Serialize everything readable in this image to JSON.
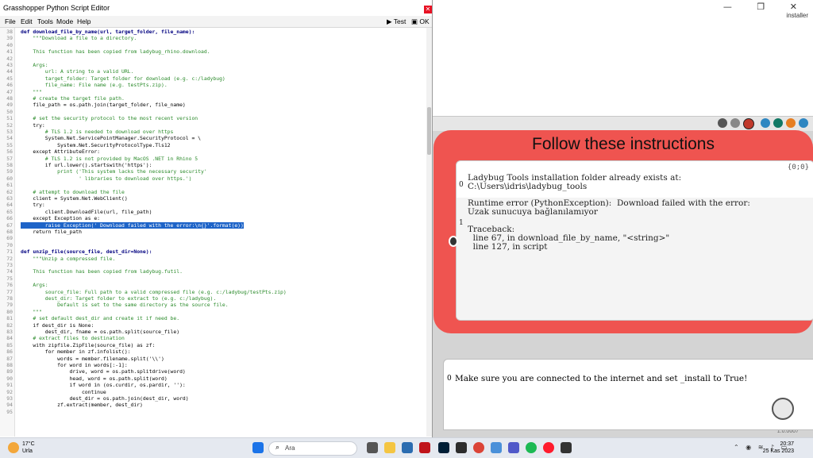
{
  "editor": {
    "title": "Grasshopper Python Script Editor",
    "close_glyph": "✕",
    "menu": [
      "File",
      "Edit",
      "Tools",
      "Mode",
      "Help"
    ],
    "test_label": "Test",
    "ok_label": "OK",
    "lines": [
      {
        "n": "38",
        "t": "def download_file_by_name(url, target_folder, file_name):",
        "k": "def"
      },
      {
        "n": "39",
        "t": "    \"\"\"Download a file to a directory.",
        "k": "str"
      },
      {
        "n": "40",
        "t": "",
        "k": ""
      },
      {
        "n": "41",
        "t": "    This function has been copied from ladybug_rhino.download.",
        "k": "str"
      },
      {
        "n": "42",
        "t": "",
        "k": ""
      },
      {
        "n": "43",
        "t": "    Args:",
        "k": "str"
      },
      {
        "n": "44",
        "t": "        url: A string to a valid URL.",
        "k": "str"
      },
      {
        "n": "45",
        "t": "        target_folder: Target folder for download (e.g. c:/ladybug)",
        "k": "str"
      },
      {
        "n": "46",
        "t": "        file_name: File name (e.g. testPts.zip).",
        "k": "str"
      },
      {
        "n": "47",
        "t": "    \"\"\"",
        "k": "str"
      },
      {
        "n": "48",
        "t": "    # create the target file path.",
        "k": "cmt"
      },
      {
        "n": "49",
        "t": "    file_path = os.path.join(target_folder, file_name)",
        "k": ""
      },
      {
        "n": "50",
        "t": "",
        "k": ""
      },
      {
        "n": "51",
        "t": "    # set the security protocol to the most recent version",
        "k": "cmt"
      },
      {
        "n": "52",
        "t": "    try:",
        "k": "kw"
      },
      {
        "n": "53",
        "t": "        # TLS 1.2 is needed to download over https",
        "k": "cmt"
      },
      {
        "n": "54",
        "t": "        System.Net.ServicePointManager.SecurityProtocol = \\",
        "k": ""
      },
      {
        "n": "55",
        "t": "            System.Net.SecurityProtocolType.Tls12",
        "k": ""
      },
      {
        "n": "56",
        "t": "    except AttributeError:",
        "k": "kw"
      },
      {
        "n": "57",
        "t": "        # TLS 1.2 is not provided by MacOS .NET in Rhino 5",
        "k": "cmt"
      },
      {
        "n": "58",
        "t": "        if url.lower().startswith('https'):",
        "k": "kw"
      },
      {
        "n": "59",
        "t": "            print ('This system lacks the necessary security'",
        "k": "str"
      },
      {
        "n": "60",
        "t": "                   ' libraries to download over https.')",
        "k": "str"
      },
      {
        "n": "61",
        "t": "",
        "k": ""
      },
      {
        "n": "62",
        "t": "    # attempt to download the file",
        "k": "cmt"
      },
      {
        "n": "63",
        "t": "    client = System.Net.WebClient()",
        "k": ""
      },
      {
        "n": "64",
        "t": "    try:",
        "k": "kw"
      },
      {
        "n": "65",
        "t": "        client.DownloadFile(url, file_path)",
        "k": ""
      },
      {
        "n": "66",
        "t": "    except Exception as e:",
        "k": "kw"
      },
      {
        "n": "67",
        "t": "        raise Exception(' Download failed with the error:\\n{}'.format(e))",
        "k": "hl"
      },
      {
        "n": "68",
        "t": "    return file_path",
        "k": "kw"
      },
      {
        "n": "69",
        "t": "",
        "k": ""
      },
      {
        "n": "70",
        "t": "",
        "k": ""
      },
      {
        "n": "71",
        "t": "def unzip_file(source_file, dest_dir=None):",
        "k": "def"
      },
      {
        "n": "72",
        "t": "    \"\"\"Unzip a compressed file.",
        "k": "str"
      },
      {
        "n": "73",
        "t": "",
        "k": ""
      },
      {
        "n": "74",
        "t": "    This function has been copied from ladybug.futil.",
        "k": "str"
      },
      {
        "n": "75",
        "t": "",
        "k": ""
      },
      {
        "n": "76",
        "t": "    Args:",
        "k": "str"
      },
      {
        "n": "77",
        "t": "        source_file: Full path to a valid compressed file (e.g. c:/ladybug/testPts.zip)",
        "k": "str"
      },
      {
        "n": "78",
        "t": "        dest_dir: Target folder to extract to (e.g. c:/ladybug).",
        "k": "str"
      },
      {
        "n": "79",
        "t": "            Default is set to the same directory as the source file.",
        "k": "str"
      },
      {
        "n": "80",
        "t": "    \"\"\"",
        "k": "str"
      },
      {
        "n": "81",
        "t": "    # set default dest_dir and create it if need be.",
        "k": "cmt"
      },
      {
        "n": "82",
        "t": "    if dest_dir is None:",
        "k": "kw"
      },
      {
        "n": "83",
        "t": "        dest_dir, fname = os.path.split(source_file)",
        "k": ""
      },
      {
        "n": "84",
        "t": "    # extract files to destination",
        "k": "cmt"
      },
      {
        "n": "85",
        "t": "    with zipfile.ZipFile(source_file) as zf:",
        "k": "kw"
      },
      {
        "n": "86",
        "t": "        for member in zf.infolist():",
        "k": "kw"
      },
      {
        "n": "87",
        "t": "            words = member.filename.split('\\\\')",
        "k": ""
      },
      {
        "n": "88",
        "t": "            for word in words[:-1]:",
        "k": "kw"
      },
      {
        "n": "89",
        "t": "                drive, word = os.path.splitdrive(word)",
        "k": ""
      },
      {
        "n": "90",
        "t": "                head, word = os.path.split(word)",
        "k": ""
      },
      {
        "n": "91",
        "t": "                if word in (os.curdir, os.pardir, ''):",
        "k": "kw"
      },
      {
        "n": "92",
        "t": "                    continue",
        "k": "kw"
      },
      {
        "n": "93",
        "t": "                dest_dir = os.path.join(dest_dir, word)",
        "k": ""
      },
      {
        "n": "94",
        "t": "            zf.extract(member, dest_dir)",
        "k": ""
      },
      {
        "n": "95",
        "t": "",
        "k": ""
      }
    ]
  },
  "grasshopper": {
    "window_controls": "—  ❐  ✕",
    "installer_label": "installer",
    "component_title": "Follow these instructions",
    "panel_path": "{0;0}",
    "panel_rows": [
      {
        "idx": "0",
        "text": "Ladybug Tools installation folder already exists at:\nC:\\Users\\idris\\ladybug_tools"
      },
      {
        "idx": "1",
        "text": "Runtime error (PythonException):  Download failed with the error:\nUzak sunucuya bağlanılamıyor\n\nTraceback:\n  line 67, in download_file_by_name, \"<string>\"\n  line 127, in script"
      }
    ],
    "message_idx": "0",
    "message_text": "Make sure you are connected to the internet and set _install to True!",
    "version": "1.0.0007"
  },
  "taskbar": {
    "temperature": "17°C",
    "location": "Urla",
    "search_placeholder": "Ara",
    "time": "20:37",
    "date": "25 Kas 2023"
  }
}
